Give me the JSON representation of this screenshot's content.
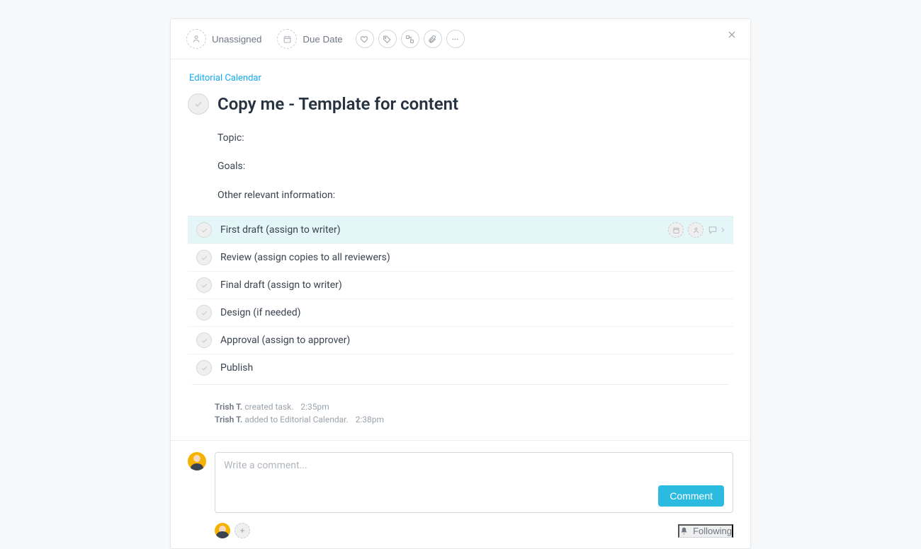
{
  "header": {
    "assignee_label": "Unassigned",
    "due_label": "Due Date"
  },
  "project_link": "Editorial Calendar",
  "task_title": "Copy me - Template for content",
  "description": {
    "line1": "Topic:",
    "line2": "Goals:",
    "line3": "Other relevant information:"
  },
  "subtasks": [
    {
      "title": "First draft (assign to writer)",
      "highlight": true
    },
    {
      "title": "Review (assign copies to all reviewers)"
    },
    {
      "title": "Final draft (assign to writer)"
    },
    {
      "title": "Design (if needed)"
    },
    {
      "title": "Approval (assign to approver)"
    },
    {
      "title": "Publish"
    }
  ],
  "activity": [
    {
      "actor": "Trish T.",
      "action": "created task.",
      "time": "2:35pm"
    },
    {
      "actor": "Trish T.",
      "action": "added to Editorial Calendar.",
      "time": "2:38pm"
    }
  ],
  "composer": {
    "placeholder": "Write a comment...",
    "submit_label": "Comment"
  },
  "footer": {
    "following_label": "Following"
  }
}
